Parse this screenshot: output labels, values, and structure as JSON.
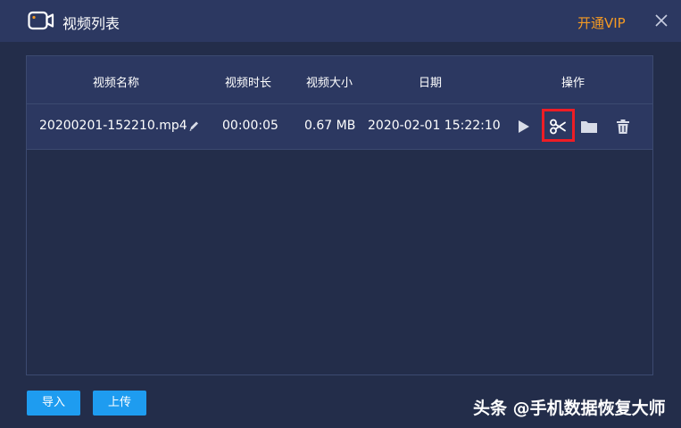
{
  "window": {
    "title": "视频列表",
    "vip_label": "开通VIP",
    "icons": {
      "title": "video-camera-icon",
      "close": "close-icon"
    }
  },
  "table": {
    "headers": [
      "视频名称",
      "视频时长",
      "视频大小",
      "日期",
      "操作"
    ],
    "rows": [
      {
        "name": "20200201-152210.mp4",
        "duration": "00:00:05",
        "size": "0.67 MB",
        "date": "2020-02-01 15:22:10",
        "actions": [
          "play-icon",
          "scissors-icon",
          "folder-icon",
          "trash-icon"
        ],
        "highlighted_action": "scissors-icon"
      }
    ]
  },
  "footer": {
    "import_label": "导入",
    "upload_label": "上传"
  },
  "watermark": "头条 @手机数据恢复大师",
  "colors": {
    "accent": "#1e9cf0",
    "vip": "#f59a23",
    "highlight": "#ee1d25",
    "background": "#232d4a",
    "header_bg": "#2c3861"
  }
}
